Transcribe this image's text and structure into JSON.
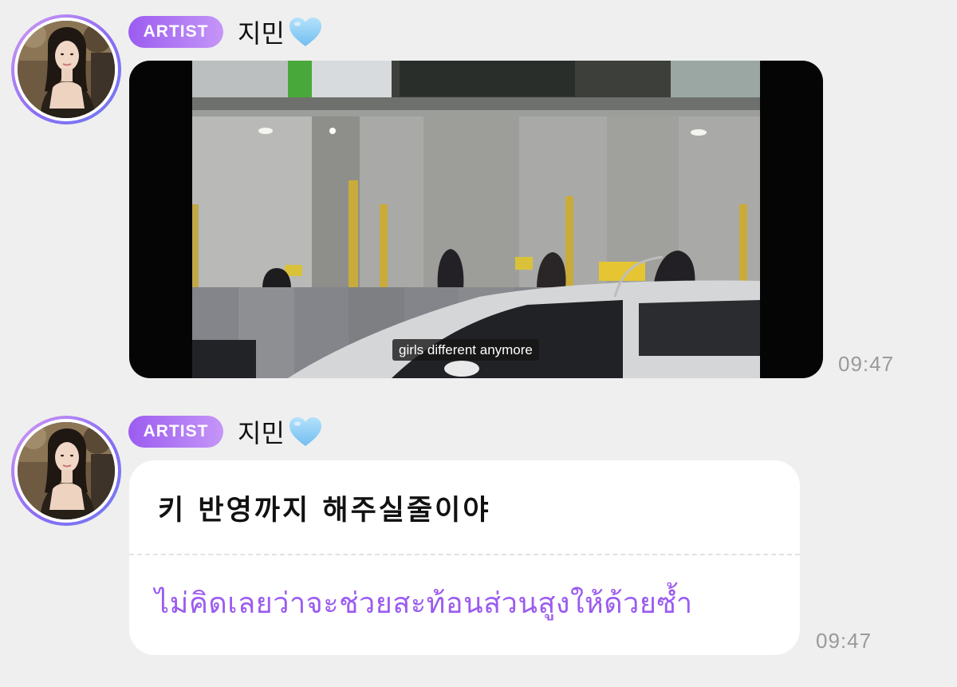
{
  "messages": [
    {
      "badge": "ARTIST",
      "sender": "지민",
      "sender_emoji": "light-blue-heart",
      "type": "video",
      "subtitle": "girls different anymore",
      "time": "09:47"
    },
    {
      "badge": "ARTIST",
      "sender": "지민",
      "sender_emoji": "light-blue-heart",
      "type": "text",
      "text": "키 반영까지 해주실줄이야",
      "translation": "ไม่คิดเลยว่าจะช่วยสะท้อนส่วนสูงให้ด้วยซ้ำ",
      "time": "09:47"
    }
  ],
  "colors": {
    "background": "#efefef",
    "badge_gradient_start": "#9b5cf0",
    "badge_gradient_end": "#c596f7",
    "translation_text": "#9b5cef",
    "timestamp": "#9a9a9a",
    "heart": "#8fd0f5"
  }
}
